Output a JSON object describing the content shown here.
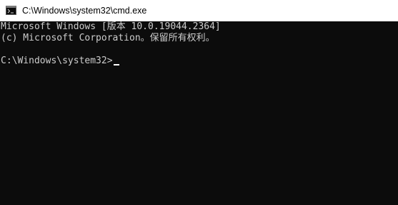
{
  "window": {
    "title": "C:\\Windows\\system32\\cmd.exe",
    "icon": "cmd-icon"
  },
  "console": {
    "lines": [
      "Microsoft Windows [版本 10.0.19044.2364]",
      "(c) Microsoft Corporation。保留所有权利。",
      ""
    ],
    "prompt": "C:\\Windows\\system32>"
  },
  "colors": {
    "background": "#0c0c0c",
    "text": "#cccccc",
    "titlebar": "#ffffff"
  }
}
